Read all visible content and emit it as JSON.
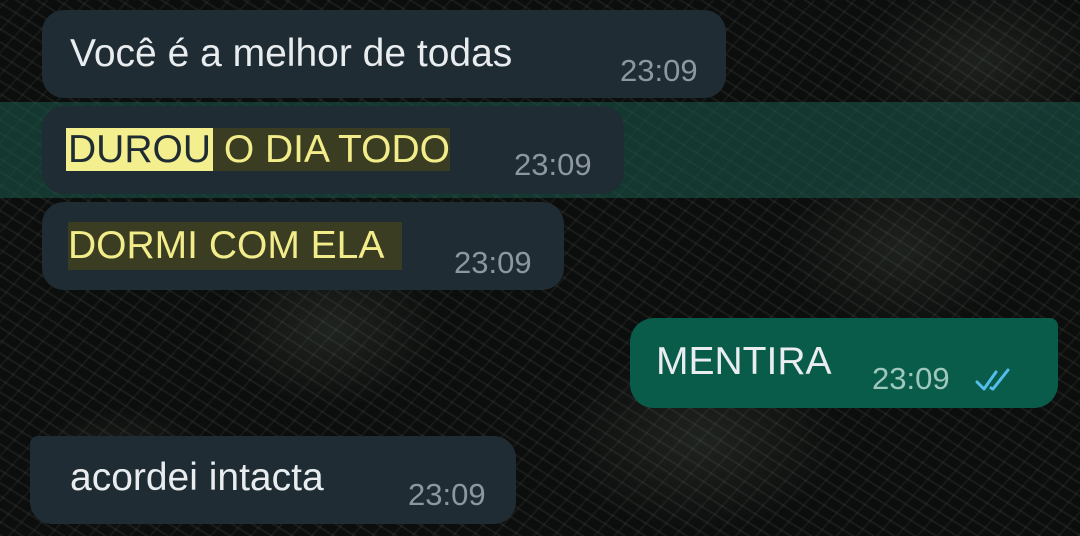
{
  "messages": [
    {
      "direction": "incoming",
      "text": "Você é a melhor de todas",
      "time": "23:09"
    },
    {
      "direction": "incoming",
      "text_highlight": "DUROU",
      "text_rest": " O DIA TODO",
      "time": "23:09"
    },
    {
      "direction": "incoming",
      "text": "DORMI COM ELA",
      "time": "23:09"
    },
    {
      "direction": "outgoing",
      "text": "MENTIRA",
      "time": "23:09",
      "status_icon": "double-check-read-icon"
    },
    {
      "direction": "incoming",
      "text": "acordei intacta",
      "time": "23:09"
    }
  ],
  "colors": {
    "incoming_bubble": "#1f2c33",
    "outgoing_bubble": "#0a5c4a",
    "read_ticks": "#53bdeb",
    "highlight_text": "#f2ec8a"
  }
}
